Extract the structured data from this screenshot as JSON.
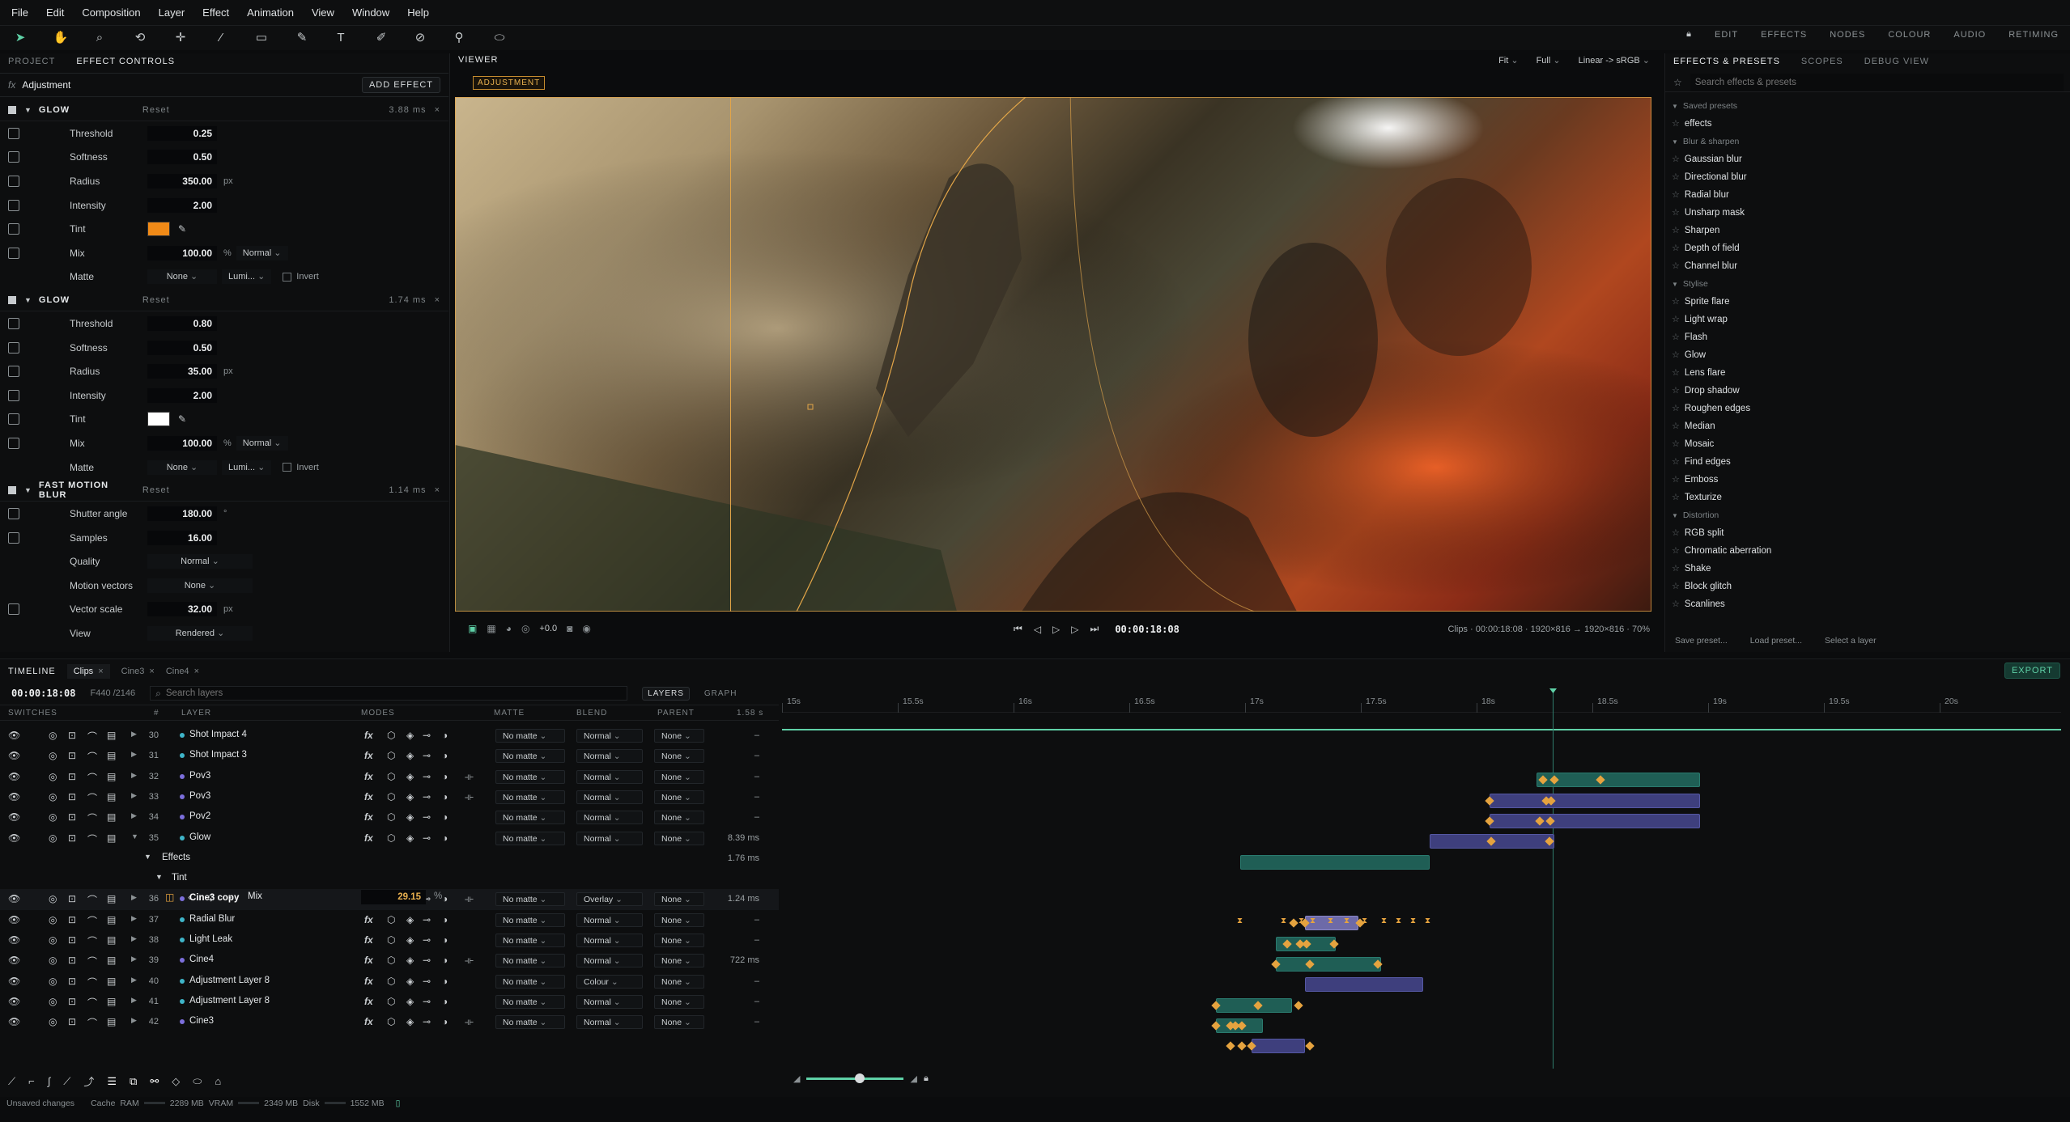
{
  "menu": [
    "File",
    "Edit",
    "Composition",
    "Layer",
    "Effect",
    "Animation",
    "View",
    "Window",
    "Help"
  ],
  "workspace_tabs": [
    "EDIT",
    "EFFECTS",
    "NODES",
    "COLOUR",
    "AUDIO",
    "RETIMING"
  ],
  "left_panel": {
    "tabs": [
      "PROJECT",
      "EFFECT CONTROLS"
    ],
    "fx_label": "fx",
    "layer_name": "Adjustment",
    "add_effect": "ADD EFFECT",
    "effects": [
      {
        "name": "GLOW",
        "reset": "Reset",
        "time": "3.88 ms",
        "params": [
          {
            "label": "Threshold",
            "value": "0.25"
          },
          {
            "label": "Softness",
            "value": "0.50"
          },
          {
            "label": "Radius",
            "value": "350.00",
            "unit": "px"
          },
          {
            "label": "Intensity",
            "value": "2.00"
          },
          {
            "label": "Tint",
            "color": "#f08a17"
          },
          {
            "label": "Mix",
            "value": "100.00",
            "unit": "%",
            "blend": "Normal"
          },
          {
            "label": "Matte",
            "matte": "None",
            "lumi": "Lumi...",
            "invert": "Invert"
          }
        ]
      },
      {
        "name": "GLOW",
        "reset": "Reset",
        "time": "1.74 ms",
        "params": [
          {
            "label": "Threshold",
            "value": "0.80"
          },
          {
            "label": "Softness",
            "value": "0.50"
          },
          {
            "label": "Radius",
            "value": "35.00",
            "unit": "px"
          },
          {
            "label": "Intensity",
            "value": "2.00"
          },
          {
            "label": "Tint",
            "color": "#ffffff"
          },
          {
            "label": "Mix",
            "value": "100.00",
            "unit": "%",
            "blend": "Normal"
          },
          {
            "label": "Matte",
            "matte": "None",
            "lumi": "Lumi...",
            "invert": "Invert"
          }
        ]
      },
      {
        "name": "FAST MOTION BLUR",
        "reset": "Reset",
        "time": "1.14 ms",
        "params": [
          {
            "label": "Shutter angle",
            "value": "180.00",
            "unit": "°"
          },
          {
            "label": "Samples",
            "value": "16.00"
          },
          {
            "label": "Quality",
            "select": "Normal"
          },
          {
            "label": "Motion vectors",
            "select": "None"
          },
          {
            "label": "Vector scale",
            "value": "32.00",
            "unit": "px"
          },
          {
            "label": "View",
            "select": "Rendered"
          }
        ]
      }
    ]
  },
  "viewer": {
    "title": "VIEWER",
    "badge": "ADJUSTMENT",
    "fit": "Fit",
    "res": "Full",
    "colorspace": "Linear -> sRGB",
    "exposure": "+0.0",
    "timecode": "00:00:18:08",
    "status": "Clips · 00:00:18:08 · 1920×816 → 1920×816 · 70%"
  },
  "right_panel": {
    "tabs": [
      "EFFECTS & PRESETS",
      "SCOPES",
      "DEBUG VIEW"
    ],
    "search_placeholder": "Search effects & presets",
    "groups": [
      {
        "name": "Saved presets",
        "items": [
          "effects"
        ]
      },
      {
        "name": "Blur & sharpen",
        "items": [
          "Gaussian blur",
          "Directional blur",
          "Radial blur",
          "Unsharp mask",
          "Sharpen",
          "Depth of field",
          "Channel blur"
        ]
      },
      {
        "name": "Stylise",
        "items": [
          "Sprite flare",
          "Light wrap",
          "Flash",
          "Glow",
          "Lens flare",
          "Drop shadow",
          "Roughen edges",
          "Median",
          "Mosaic",
          "Find edges",
          "Emboss",
          "Texturize"
        ]
      },
      {
        "name": "Distortion",
        "items": [
          "RGB split",
          "Chromatic aberration",
          "Shake",
          "Block glitch",
          "Scanlines"
        ]
      }
    ],
    "footer": [
      "Save preset...",
      "Load preset...",
      "Select a layer"
    ]
  },
  "timeline": {
    "label": "TIMELINE",
    "tabs": [
      "Clips",
      "Cine3",
      "Cine4"
    ],
    "timecode": "00:00:18:08",
    "frame": "F440",
    "total": "/2146",
    "search_placeholder": "Search layers",
    "view_tabs": [
      "LAYERS",
      "GRAPH"
    ],
    "export": "EXPORT",
    "columns": {
      "switches": "SWITCHES",
      "num": "#",
      "layer": "LAYER",
      "modes": "MODES",
      "matte": "MATTE",
      "blend": "BLEND",
      "parent": "PARENT",
      "time": "1.58 s"
    },
    "ruler": [
      "15s",
      "15.5s",
      "16s",
      "16.5s",
      "17s",
      "17.5s",
      "18s",
      "18.5s",
      "19s",
      "19.5s",
      "20s"
    ],
    "layers": [
      {
        "num": "30",
        "name": "Shot Impact 4",
        "dot": "#3fb5c9",
        "matte": "No matte",
        "blend": "Normal",
        "parent": "None",
        "time": "–"
      },
      {
        "num": "31",
        "name": "Shot Impact 3",
        "dot": "#3fb5c9",
        "matte": "No matte",
        "blend": "Normal",
        "parent": "None",
        "time": "–"
      },
      {
        "num": "32",
        "name": "Pov3",
        "dot": "#7c6fdc",
        "matte": "No matte",
        "blend": "Normal",
        "parent": "None",
        "time": "–"
      },
      {
        "num": "33",
        "name": "Pov3",
        "dot": "#7c6fdc",
        "matte": "No matte",
        "blend": "Normal",
        "parent": "None",
        "time": "–"
      },
      {
        "num": "34",
        "name": "Pov2",
        "dot": "#7c6fdc",
        "matte": "No matte",
        "blend": "Normal",
        "parent": "None",
        "time": "–"
      },
      {
        "num": "35",
        "name": "Glow",
        "dot": "#3fb5c9",
        "matte": "No matte",
        "blend": "Normal",
        "parent": "None",
        "time": "8.39 ms"
      },
      {
        "num": "36",
        "name": "Cine3 copy",
        "dot": "#7c6fdc",
        "matte": "No matte",
        "blend": "Overlay",
        "parent": "None",
        "time": "1.24 ms"
      },
      {
        "num": "37",
        "name": "Radial Blur",
        "dot": "#3fb5c9",
        "matte": "No matte",
        "blend": "Normal",
        "parent": "None",
        "time": "–"
      },
      {
        "num": "38",
        "name": "Light Leak",
        "dot": "#3fb5c9",
        "matte": "No matte",
        "blend": "Normal",
        "parent": "None",
        "time": "–"
      },
      {
        "num": "39",
        "name": "Cine4",
        "dot": "#7c6fdc",
        "matte": "No matte",
        "blend": "Normal",
        "parent": "None",
        "time": "722 ms"
      },
      {
        "num": "40",
        "name": "Adjustment Layer 8",
        "dot": "#3fb5c9",
        "matte": "No matte",
        "blend": "Colour",
        "parent": "None",
        "time": "–"
      },
      {
        "num": "41",
        "name": "Adjustment Layer 8",
        "dot": "#3fb5c9",
        "matte": "No matte",
        "blend": "Normal",
        "parent": "None",
        "time": "–"
      },
      {
        "num": "42",
        "name": "Cine3",
        "dot": "#7c6fdc",
        "matte": "No matte",
        "blend": "Normal",
        "parent": "None",
        "time": "–"
      }
    ],
    "effects_label": "Effects",
    "effects_time": "1.76 ms",
    "tint_label": "Tint",
    "mix_label": "Mix",
    "mix_value": "29.15",
    "mix_unit": "%"
  },
  "status": {
    "unsaved": "Unsaved changes",
    "cache": "Cache",
    "ram_label": "RAM",
    "ram": "2289 MB",
    "vram_label": "VRAM",
    "vram": "2349 MB",
    "disk_label": "Disk",
    "disk": "1552 MB"
  }
}
